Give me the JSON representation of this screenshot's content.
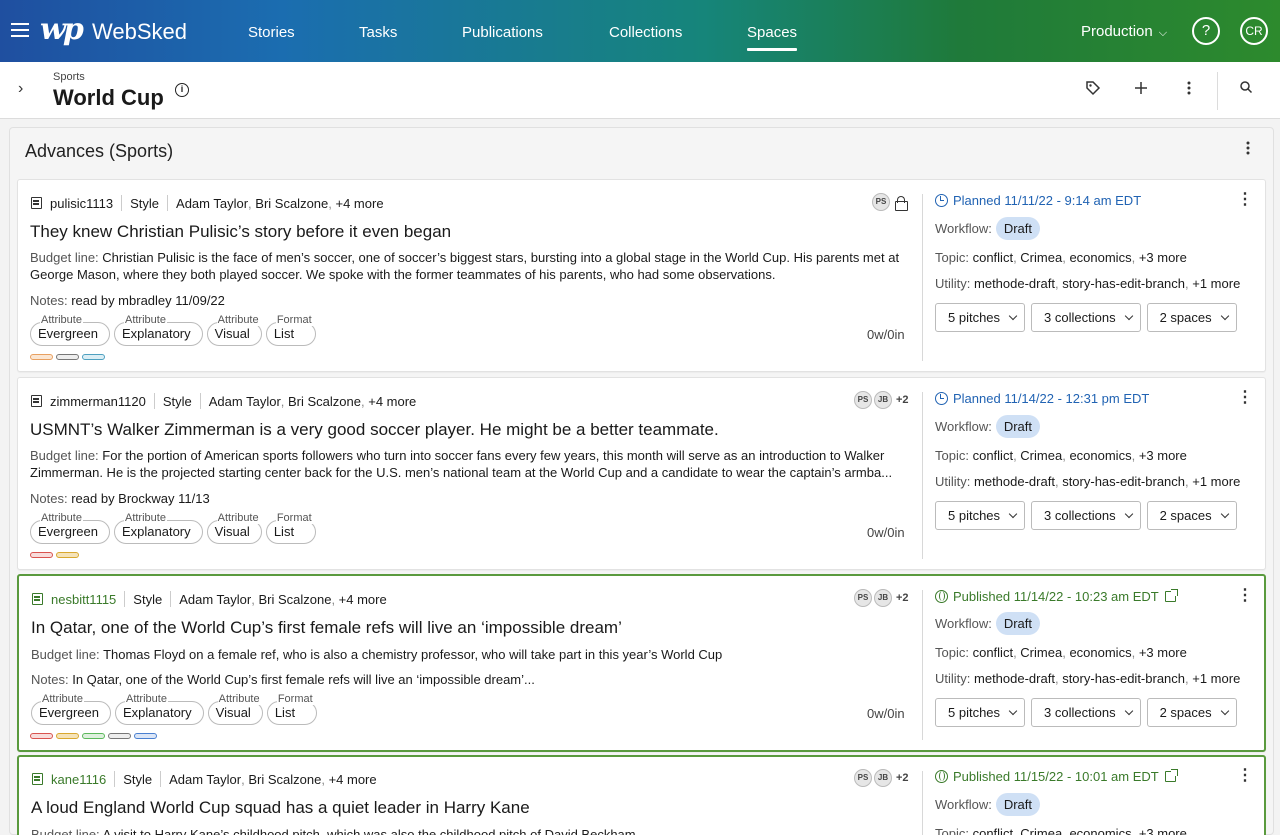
{
  "nav": {
    "app_name": "WebSked",
    "logo": "wp",
    "items": [
      {
        "label": "Stories"
      },
      {
        "label": "Tasks"
      },
      {
        "label": "Publications"
      },
      {
        "label": "Collections"
      },
      {
        "label": "Spaces",
        "active": true
      }
    ],
    "environment": "Production",
    "help_icon": "?",
    "user_initials": "CR"
  },
  "subheader": {
    "breadcrumb": "Sports",
    "title": "World Cup"
  },
  "panel": {
    "title": "Advances (Sports)"
  },
  "stories": [
    {
      "slug": "pulisic1113",
      "section": "Style",
      "authors": [
        "Adam Taylor",
        "Bri Scalzone"
      ],
      "more_authors": "+4 more",
      "avatars": [
        "PS"
      ],
      "avatar_more": "",
      "locked": true,
      "headline": "They knew Christian Pulisic’s story before it even began",
      "budget_label": "Budget line:",
      "budget": "Christian Pulisic is the face of men’s soccer, one of soccer’s biggest stars, bursting into a global stage in the World Cup. His parents met at George Mason, where they both played soccer. We spoke with the former teammates of his parents, who had some observations.",
      "notes_label": "Notes:",
      "notes": "read by mbradley 11/09/22",
      "attributes": [
        {
          "label": "Attribute",
          "value": "Evergreen"
        },
        {
          "label": "Attribute",
          "value": "Explanatory"
        },
        {
          "label": "Attribute",
          "value": "Visual"
        },
        {
          "label": "Format",
          "value": "List"
        }
      ],
      "word_count": "0w/0in",
      "color_dots": [
        "#e8a060",
        "#777777",
        "#4ea0c0"
      ],
      "status": "Planned 11/11/22 - 9:14 am EDT",
      "status_type": "planned",
      "workflow_label": "Workflow:",
      "workflow": "Draft",
      "topic_label": "Topic:",
      "topics": [
        "conflict",
        "Crimea",
        "economics"
      ],
      "topic_more": "+3 more",
      "utility_label": "Utility:",
      "utilities": [
        "methode-draft",
        "story-has-edit-branch"
      ],
      "utility_more": "+1 more",
      "pitches": "5 pitches",
      "collections": "3 collections",
      "spaces": "2 spaces"
    },
    {
      "slug": "zimmerman1120",
      "section": "Style",
      "authors": [
        "Adam Taylor",
        "Bri Scalzone"
      ],
      "more_authors": "+4 more",
      "avatars": [
        "PS",
        "JB"
      ],
      "avatar_more": "+2",
      "locked": false,
      "headline": "USMNT’s Walker Zimmerman is a very good soccer player. He might be a better teammate.",
      "budget_label": "Budget line:",
      "budget": "For the portion of American sports followers who turn into soccer fans every few years, this month will serve as an introduction to Walker Zimmerman. He is the projected starting center back for the U.S. men’s national team at the World Cup and a candidate to wear the captain’s armba...",
      "notes_label": "Notes:",
      "notes": "read by Brockway 11/13",
      "attributes": [
        {
          "label": "Attribute",
          "value": "Evergreen"
        },
        {
          "label": "Attribute",
          "value": "Explanatory"
        },
        {
          "label": "Attribute",
          "value": "Visual"
        },
        {
          "label": "Format",
          "value": "List"
        }
      ],
      "word_count": "0w/0in",
      "color_dots": [
        "#d9534f",
        "#d9a830"
      ],
      "status": "Planned 11/14/22 - 12:31 pm EDT",
      "status_type": "planned",
      "workflow_label": "Workflow:",
      "workflow": "Draft",
      "topic_label": "Topic:",
      "topics": [
        "conflict",
        "Crimea",
        "economics"
      ],
      "topic_more": "+3 more",
      "utility_label": "Utility:",
      "utilities": [
        "methode-draft",
        "story-has-edit-branch"
      ],
      "utility_more": "+1 more",
      "pitches": "5 pitches",
      "collections": "3 collections",
      "spaces": "2 spaces"
    },
    {
      "slug": "nesbitt1115",
      "section": "Style",
      "authors": [
        "Adam Taylor",
        "Bri Scalzone"
      ],
      "more_authors": "+4 more",
      "avatars": [
        "PS",
        "JB"
      ],
      "avatar_more": "+2",
      "locked": false,
      "headline": "In Qatar, one of the World Cup’s first female refs will live an ‘impossible dream’",
      "budget_label": "Budget line:",
      "budget": "Thomas Floyd on a female ref, who is also a chemistry professor, who will take part in this year’s World Cup",
      "notes_label": "Notes:",
      "notes": "In Qatar, one of the World Cup’s first female refs will live an ‘impossible dream’...",
      "attributes": [
        {
          "label": "Attribute",
          "value": "Evergreen"
        },
        {
          "label": "Attribute",
          "value": "Explanatory"
        },
        {
          "label": "Attribute",
          "value": "Visual"
        },
        {
          "label": "Format",
          "value": "List"
        }
      ],
      "word_count": "0w/0in",
      "color_dots": [
        "#d9534f",
        "#d9a830",
        "#5cb85c",
        "#777777",
        "#4a80d0"
      ],
      "status": "Published 11/14/22 - 10:23 am EDT",
      "status_type": "published",
      "workflow_label": "Workflow:",
      "workflow": "Draft",
      "topic_label": "Topic:",
      "topics": [
        "conflict",
        "Crimea",
        "economics"
      ],
      "topic_more": "+3 more",
      "utility_label": "Utility:",
      "utilities": [
        "methode-draft",
        "story-has-edit-branch"
      ],
      "utility_more": "+1 more",
      "pitches": "5 pitches",
      "collections": "3 collections",
      "spaces": "2 spaces"
    },
    {
      "slug": "kane1116",
      "section": "Style",
      "authors": [
        "Adam Taylor",
        "Bri Scalzone"
      ],
      "more_authors": "+4 more",
      "avatars": [
        "PS",
        "JB"
      ],
      "avatar_more": "+2",
      "locked": false,
      "headline": "A loud England World Cup squad has a quiet leader in Harry Kane",
      "budget_label": "Budget line:",
      "budget": "A visit to Harry Kane’s childhood pitch, which was also the childhood pitch of David Beckham",
      "status": "Published 11/15/22 - 10:01 am EDT",
      "status_type": "published",
      "workflow_label": "Workflow:",
      "workflow": "Draft",
      "topic_label": "Topic:",
      "topics": [
        "conflict",
        "Crimea",
        "economics"
      ],
      "topic_more": "+3 more"
    }
  ],
  "colors": {
    "planned": "#2163b3",
    "published": "#3a7a2a",
    "workflow_pill": "#cfe0f5"
  }
}
